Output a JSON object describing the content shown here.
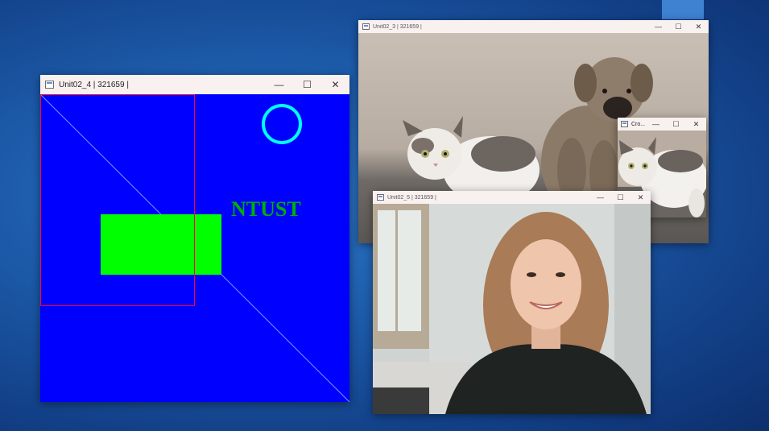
{
  "desktop": {
    "background_color": "#1c5aa8"
  },
  "windows": {
    "unit02_4": {
      "title": "Unit02_4 | 321659 |",
      "controls": {
        "minimize": "—",
        "maximize": "☐",
        "close": "✕"
      },
      "canvas": {
        "background_color": "#0000ff",
        "text": "NTUST",
        "text_color": "#00b000",
        "rectangle_color": "#00ff00",
        "circle_color": "#00ffff",
        "line_color": "#6fa0ff",
        "outline_color": "#ff0033"
      }
    },
    "unit02_3": {
      "title": "Unit02_3 | 321659 |",
      "controls": {
        "minimize": "—",
        "maximize": "☐",
        "close": "✕"
      },
      "image": "cat-and-puppy-photo"
    },
    "crop": {
      "title": "Cro...",
      "controls": {
        "minimize": "—",
        "maximize": "☐",
        "close": "✕"
      },
      "image": "cropped-cat-photo"
    },
    "unit02_5": {
      "title": "Unit02_5 | 321659 |",
      "controls": {
        "minimize": "—",
        "maximize": "☐",
        "close": "✕"
      },
      "image": "webcam-woman-photo"
    }
  }
}
